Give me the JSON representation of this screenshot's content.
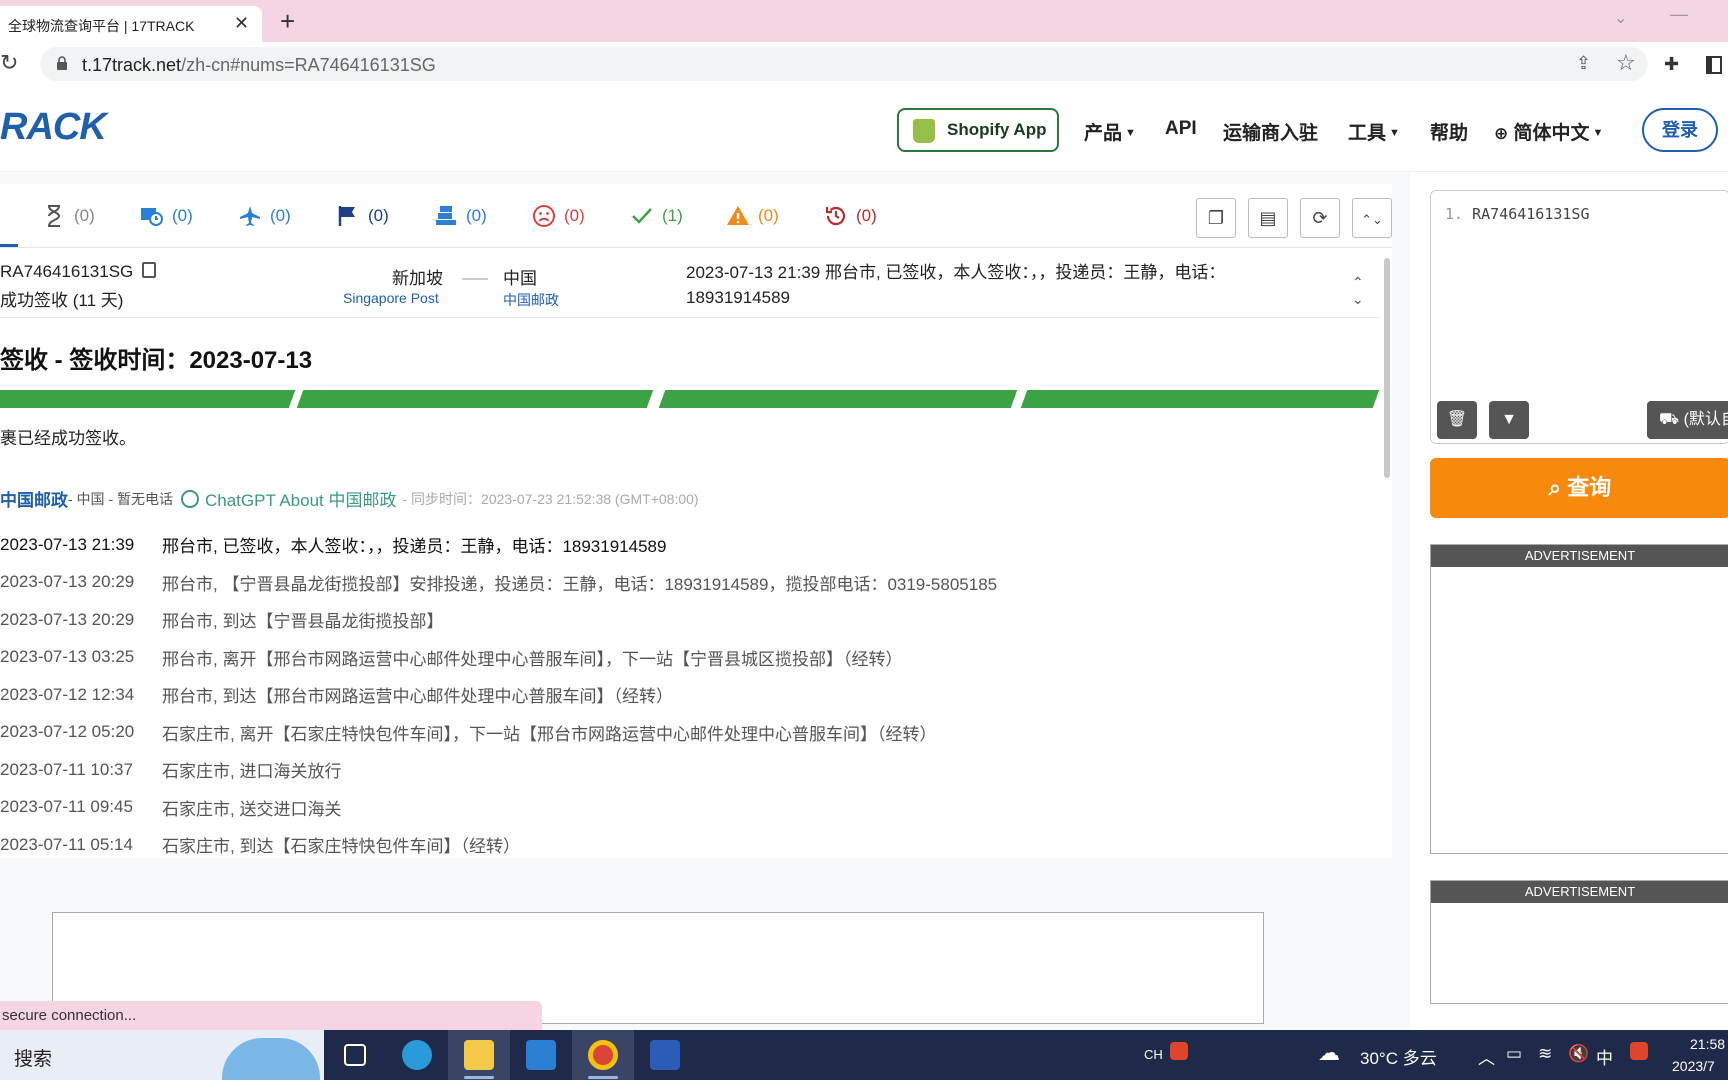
{
  "browser": {
    "tab_title": "全球物流查询平台 | 17TRACK",
    "tab_close": "✕",
    "new_tab": "+",
    "url_host": "t.17track.net",
    "url_path": "/zh-cn#nums=RA746416131SG"
  },
  "header": {
    "logo": "RACK",
    "shopify_label": "Shopify App",
    "nav": {
      "products": "产品",
      "api": "API",
      "carrier_join": "运输商入驻",
      "tools": "工具",
      "help": "帮助",
      "language": "简体中文"
    },
    "login": "登录"
  },
  "status_tabs": [
    {
      "count": "(0)",
      "color": "#888888"
    },
    {
      "count": "(0)",
      "color": "#2b7fd4"
    },
    {
      "count": "(0)",
      "color": "#2b7fd4"
    },
    {
      "count": "(0)",
      "color": "#1f3f8a"
    },
    {
      "count": "(0)",
      "color": "#2b7fd4"
    },
    {
      "count": "(0)",
      "color": "#d94040"
    },
    {
      "count": "(1)",
      "color": "#3ca345"
    },
    {
      "count": "(0)",
      "color": "#f08a1a"
    },
    {
      "count": "(0)",
      "color": "#b03030"
    }
  ],
  "shipment": {
    "number": "RA746416131SG",
    "status_days": "成功签收 (11 天)",
    "origin_country": "新加坡",
    "origin_carrier": "Singapore Post",
    "dest_country": "中国",
    "dest_carrier": "中国邮政",
    "latest_event": "2023-07-13 21:39 邢台市, 已签收，本人签收：，，投递员：王静，电话：18931914589",
    "delivered_title": "签收 - 签收时间：2023-07-13",
    "delivered_note": "裹已经成功签收。",
    "progress": 1.0
  },
  "carrier_line": {
    "name": "中国邮政",
    "meta": " - 中国 - 暂无电话",
    "gpt_link": "ChatGPT About 中国邮政",
    "sync": "- 同步时间：2023-07-23 21:52:38 (GMT+08:00)"
  },
  "events": [
    {
      "time": "2023-07-13 21:39",
      "desc": "邢台市, 已签收，本人签收：，，投递员：王静，电话：18931914589"
    },
    {
      "time": "2023-07-13 20:29",
      "desc": "邢台市, 【宁晋县晶龙街揽投部】安排投递，投递员：王静，电话：18931914589，揽投部电话：0319-5805185"
    },
    {
      "time": "2023-07-13 20:29",
      "desc": "邢台市, 到达【宁晋县晶龙街揽投部】"
    },
    {
      "time": "2023-07-13 03:25",
      "desc": "邢台市, 离开【邢台市网路运营中心邮件处理中心普服车间】，下一站【宁晋县城区揽投部】（经转）"
    },
    {
      "time": "2023-07-12 12:34",
      "desc": "邢台市, 到达【邢台市网路运营中心邮件处理中心普服车间】（经转）"
    },
    {
      "time": "2023-07-12 05:20",
      "desc": "石家庄市, 离开【石家庄特快包件车间】，下一站【邢台市网路运营中心邮件处理中心普服车间】（经转）"
    },
    {
      "time": "2023-07-11 10:37",
      "desc": "石家庄市, 进口海关放行"
    },
    {
      "time": "2023-07-11 09:45",
      "desc": "石家庄市, 送交进口海关"
    },
    {
      "time": "2023-07-11 05:14",
      "desc": "石家庄市, 到达【石家庄特快包件车间】（经转）"
    }
  ],
  "right": {
    "input_line_no": "1.",
    "input_value": "RA746416131SG",
    "carrier_select": "(默认自",
    "search_label": "查询",
    "ad_label": "ADVERTISEMENT"
  },
  "status_bubble": "secure connection...",
  "taskbar": {
    "search": "搜索",
    "ime_ch": "CH",
    "weather": "30°C 多云",
    "ime_zh": "中",
    "time": "21:58",
    "date": "2023/7"
  }
}
